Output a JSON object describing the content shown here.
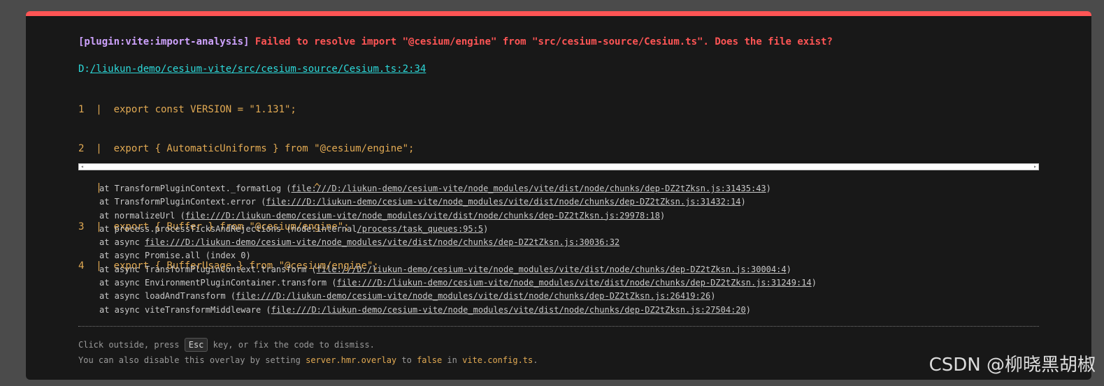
{
  "error": {
    "plugin": "[plugin:vite:import-analysis]",
    "message": "Failed to resolve import \"@cesium/engine\" from \"src/cesium-source/Cesium.ts\". Does the file exist?"
  },
  "file": {
    "drive": "D:",
    "path": "/liukun-demo/cesium-vite/src/cesium-source/Cesium.ts:2:34"
  },
  "frame": [
    "1  |  export const VERSION = \"1.131\";",
    "2  |  export { AutomaticUniforms } from \"@cesium/engine\";",
    "   |                                    ^",
    "3  |  export { Buffer } from \"@cesium/engine\";",
    "4  |  export { BufferUsage } from \"@cesium/engine\";"
  ],
  "scrollbar": {
    "left_arrow": "◂",
    "right_arrow": "▸"
  },
  "stack": [
    {
      "pre": "at TransformPluginContext._formatLog (",
      "link": "file:///D:/liukun-demo/cesium-vite/node_modules/vite/dist/node/chunks/dep-DZ2tZksn.js:31435:43",
      "post": ")"
    },
    {
      "pre": "at TransformPluginContext.error (",
      "link": "file:///D:/liukun-demo/cesium-vite/node_modules/vite/dist/node/chunks/dep-DZ2tZksn.js:31432:14",
      "post": ")"
    },
    {
      "pre": "at normalizeUrl (",
      "link": "file:///D:/liukun-demo/cesium-vite/node_modules/vite/dist/node/chunks/dep-DZ2tZksn.js:29978:18",
      "post": ")"
    },
    {
      "pre": "at process.processTicksAndRejections (node:internal",
      "link": "/process/task_queues:95:5",
      "post": ")"
    },
    {
      "pre": "at async ",
      "link": "file:///D:/liukun-demo/cesium-vite/node_modules/vite/dist/node/chunks/dep-DZ2tZksn.js:30036:32",
      "post": ""
    },
    {
      "pre": "at async Promise.all (index 0)",
      "link": "",
      "post": ""
    },
    {
      "pre": "at async TransformPluginContext.transform (",
      "link": "file:///D:/liukun-demo/cesium-vite/node_modules/vite/dist/node/chunks/dep-DZ2tZksn.js:30004:4",
      "post": ")"
    },
    {
      "pre": "at async EnvironmentPluginContainer.transform (",
      "link": "file:///D:/liukun-demo/cesium-vite/node_modules/vite/dist/node/chunks/dep-DZ2tZksn.js:31249:14",
      "post": ")"
    },
    {
      "pre": "at async loadAndTransform (",
      "link": "file:///D:/liukun-demo/cesium-vite/node_modules/vite/dist/node/chunks/dep-DZ2tZksn.js:26419:26",
      "post": ")"
    },
    {
      "pre": "at async viteTransformMiddleware (",
      "link": "file:///D:/liukun-demo/cesium-vite/node_modules/vite/dist/node/chunks/dep-DZ2tZksn.js:27504:20",
      "post": ")"
    }
  ],
  "tips": {
    "line1_a": "Click outside, press ",
    "line1_key": "Esc",
    "line1_b": " key, or fix the code to dismiss.",
    "line2_a": "You can also disable this overlay by setting ",
    "line2_code1": "server.hmr.overlay",
    "line2_b": " to ",
    "line2_code2": "false",
    "line2_c": " in ",
    "line2_code3": "vite.config.ts",
    "line2_d": "."
  },
  "watermark": "CSDN @柳晓黑胡椒",
  "colors": {
    "accent_red": "#ff5555",
    "plugin_purple": "#cfa3ff",
    "file_cyan": "#2dd9da",
    "code_yellow": "#e2aa53"
  }
}
